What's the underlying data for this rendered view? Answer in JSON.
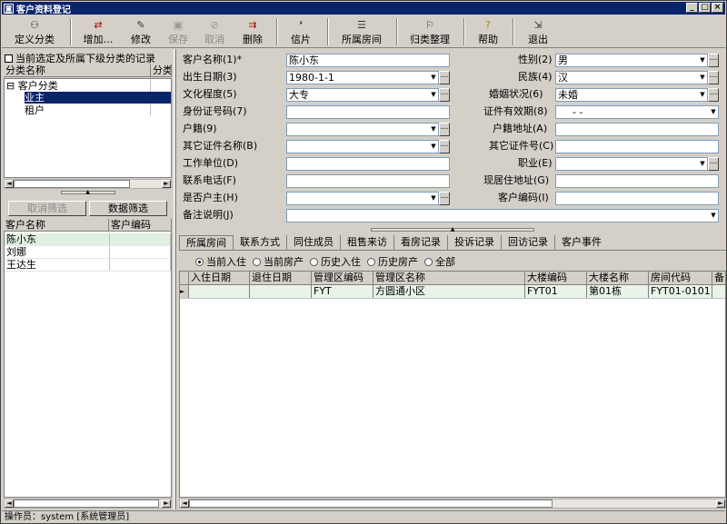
{
  "window": {
    "title": "客户资料登记",
    "icon": "app-icon",
    "buttons": [
      "_",
      "□",
      "×"
    ]
  },
  "toolbar": {
    "define_category": "定义分类",
    "add": "增加…",
    "edit": "修改",
    "save": "保存",
    "cancel": "取消",
    "delete": "删除",
    "card": "信片",
    "owned_rooms": "所属房间",
    "reorganize": "归类整理",
    "help": "帮助",
    "exit": "退出"
  },
  "left": {
    "checkbox_label": "当前选定及所属下级分类的记录",
    "tree_headers": [
      "分类名称",
      "分类"
    ],
    "tree_items": [
      "客户分类",
      "业主",
      "租户"
    ],
    "cancel_filter": "取消筛选",
    "data_filter": "数据筛选",
    "customer_headers": [
      "客户名称",
      "客户编码"
    ],
    "customers": [
      {
        "name": "陈小东",
        "code": ""
      },
      {
        "name": "刘娜",
        "code": ""
      },
      {
        "name": "王达生",
        "code": ""
      }
    ]
  },
  "form": {
    "customer_name_label": "客户名称(1)*",
    "customer_name": "陈小东",
    "birth_label": "出生日期(3)",
    "birth": "1980-1-1",
    "education_label": "文化程度(5)",
    "education": "大专",
    "id_no_label": "身份证号码(7)",
    "id_no": "",
    "household_label": "户籍(9)",
    "household": "",
    "other_id_name_label": "其它证件名称(B)",
    "other_id_name": "",
    "work_unit_label": "工作单位(D)",
    "work_unit": "",
    "phone_label": "联系电话(F)",
    "phone": "",
    "is_head_label": "是否户主(H)",
    "is_head": "",
    "remark_label": "备注说明(J)",
    "remark": "",
    "gender_label": "性别(2)",
    "gender": "男",
    "ethnic_label": "民族(4)",
    "ethnic": "汉",
    "marital_label": "婚姻状况(6)",
    "marital": "未婚",
    "id_valid_label": "证件有效期(8)",
    "id_valid": "-    -",
    "household_addr_label": "户籍地址(A)",
    "household_addr": "",
    "other_id_no_label": "其它证件号(C)",
    "other_id_no": "",
    "occupation_label": "职业(E)",
    "occupation": "",
    "current_addr_label": "现居住地址(G)",
    "current_addr": "",
    "customer_code_label": "客户编码(I)",
    "customer_code": ""
  },
  "tabs": [
    "所属房间",
    "联系方式",
    "同住成员",
    "租售来访",
    "看房记录",
    "投诉记录",
    "回访记录",
    "客户事件"
  ],
  "radios": [
    "当前入住",
    "当前房产",
    "历史入住",
    "历史房产",
    "全部"
  ],
  "room_grid": {
    "headers": [
      "入住日期",
      "退住日期",
      "管理区编码",
      "管理区名称",
      "大楼编码",
      "大楼名称",
      "房间代码",
      "备"
    ],
    "row": [
      "",
      "",
      "FYT",
      "方圆通小区",
      "FYT01",
      "第01栋",
      "FYT01-0101",
      ""
    ]
  },
  "status": "操作员：system [系统管理员]"
}
